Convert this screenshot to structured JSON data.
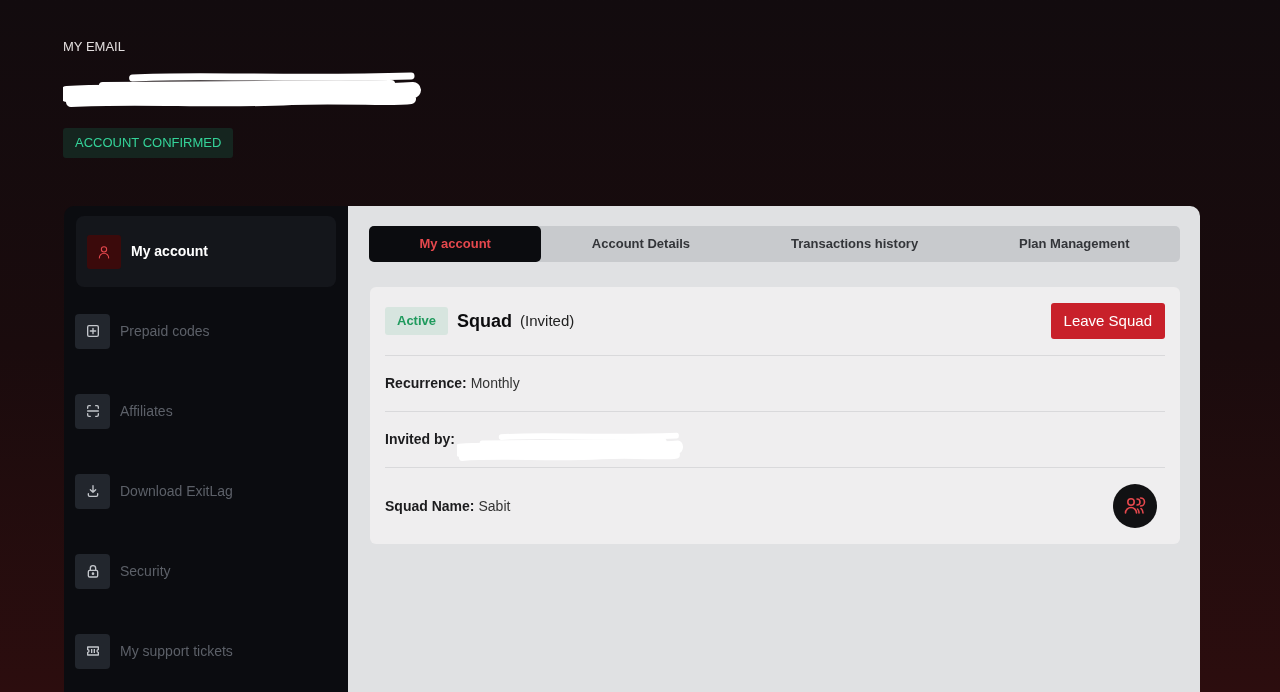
{
  "header": {
    "label": "MY EMAIL",
    "email": {
      "redacted": true
    },
    "status_badge": "ACCOUNT CONFIRMED"
  },
  "sidebar": {
    "items": [
      {
        "label": "My account",
        "selected": true
      },
      {
        "label": "Prepaid codes",
        "selected": false
      },
      {
        "label": "Affiliates",
        "selected": false
      },
      {
        "label": "Download ExitLag",
        "selected": false
      },
      {
        "label": "Security",
        "selected": false
      },
      {
        "label": "My support tickets",
        "selected": false
      }
    ]
  },
  "tabs": [
    {
      "label": "My account",
      "selected": true
    },
    {
      "label": "Account Details",
      "selected": false
    },
    {
      "label": "Transactions history",
      "selected": false
    },
    {
      "label": "Plan Management",
      "selected": false
    }
  ],
  "subscription": {
    "status": "Active",
    "plan": "Squad",
    "role": "(Invited)",
    "action": "Leave Squad",
    "details": [
      {
        "kind": "text",
        "label": "Recurrence:",
        "value": "Monthly"
      },
      {
        "kind": "redacted",
        "label": "Invited by:"
      },
      {
        "kind": "squad",
        "label": "Squad Name:",
        "value": "Sabit"
      }
    ]
  }
}
